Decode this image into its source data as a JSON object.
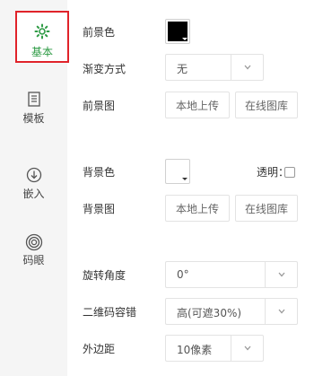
{
  "sidebar": {
    "items": [
      {
        "label": "基本",
        "icon": "gear-icon"
      },
      {
        "label": "模板",
        "icon": "template-icon"
      },
      {
        "label": "嵌入",
        "icon": "embed-icon"
      },
      {
        "label": "码眼",
        "icon": "eye-icon"
      }
    ]
  },
  "form": {
    "foreground_color": {
      "label": "前景色",
      "value": "#000000"
    },
    "gradient": {
      "label": "渐变方式",
      "value": "无"
    },
    "foreground_image": {
      "label": "前景图",
      "upload_label": "本地上传",
      "gallery_label": "在线图库"
    },
    "background_color": {
      "label": "背景色",
      "value": "#ffffff",
      "transparent_label": "透明："
    },
    "background_image": {
      "label": "背景图",
      "upload_label": "本地上传",
      "gallery_label": "在线图库"
    },
    "rotation": {
      "label": "旋转角度",
      "value": "0°"
    },
    "error_correction": {
      "label": "二维码容错",
      "value": "高(可遮30%)"
    },
    "margin": {
      "label": "外边距",
      "value": "10像素"
    }
  },
  "colors": {
    "accent_green": "#2e9b45",
    "highlight_red": "#e0232a"
  }
}
